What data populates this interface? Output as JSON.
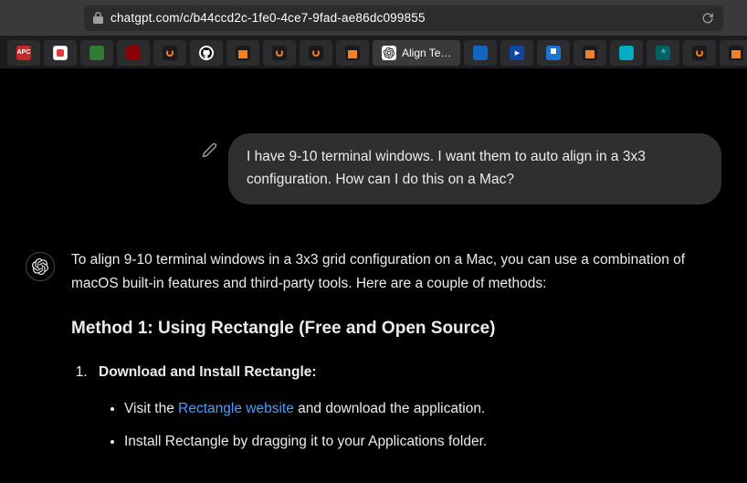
{
  "url": "chatgpt.com/c/b44ccd2c-1fe0-4ce7-9fad-ae86dc099855",
  "active_tab": {
    "title": "Align Te…"
  },
  "tabs": [
    {
      "favicon": "fav-red",
      "name": "apc"
    },
    {
      "favicon": "fav-redw",
      "name": "red-white"
    },
    {
      "favicon": "fav-green",
      "name": "green"
    },
    {
      "favicon": "fav-darkred",
      "name": "dark-red"
    },
    {
      "favicon": "fav-orange",
      "name": "orange-ring"
    },
    {
      "favicon": "fav-github",
      "name": "github"
    },
    {
      "favicon": "fav-so",
      "name": "stackoverflow-1"
    },
    {
      "favicon": "fav-orange",
      "name": "orange-ring-2"
    },
    {
      "favicon": "fav-orange",
      "name": "orange-ring-3"
    },
    {
      "favicon": "fav-so",
      "name": "stackoverflow-2"
    },
    {
      "favicon": "fav-blue",
      "name": "blue-1"
    },
    {
      "favicon": "fav-bluep",
      "name": "blue-play"
    },
    {
      "favicon": "fav-bluet",
      "name": "blue-tab"
    },
    {
      "favicon": "fav-so",
      "name": "stackoverflow-3"
    },
    {
      "favicon": "fav-cyan",
      "name": "cyan"
    },
    {
      "favicon": "fav-teal",
      "name": "teal-atom"
    },
    {
      "favicon": "fav-orange",
      "name": "orange-ring-4"
    },
    {
      "favicon": "fav-so",
      "name": "stackoverflow-4"
    },
    {
      "favicon": "fav-multi",
      "name": "multi"
    }
  ],
  "conversation": {
    "user_message": "I have 9-10 terminal windows. I want them to auto align in a 3x3 configuration. How can I do this on a Mac?",
    "assistant": {
      "intro": "To align 9-10 terminal windows in a 3x3 grid configuration on a Mac, you can use a combination of macOS built-in features and third-party tools. Here are a couple of methods:",
      "method1_heading": "Method 1: Using Rectangle (Free and Open Source)",
      "step1_title": "Download and Install Rectangle:",
      "step1_bullets": {
        "b1_pre": "Visit the ",
        "b1_link": "Rectangle website",
        "b1_post": " and download the application.",
        "b2": "Install Rectangle by dragging it to your Applications folder."
      }
    }
  }
}
